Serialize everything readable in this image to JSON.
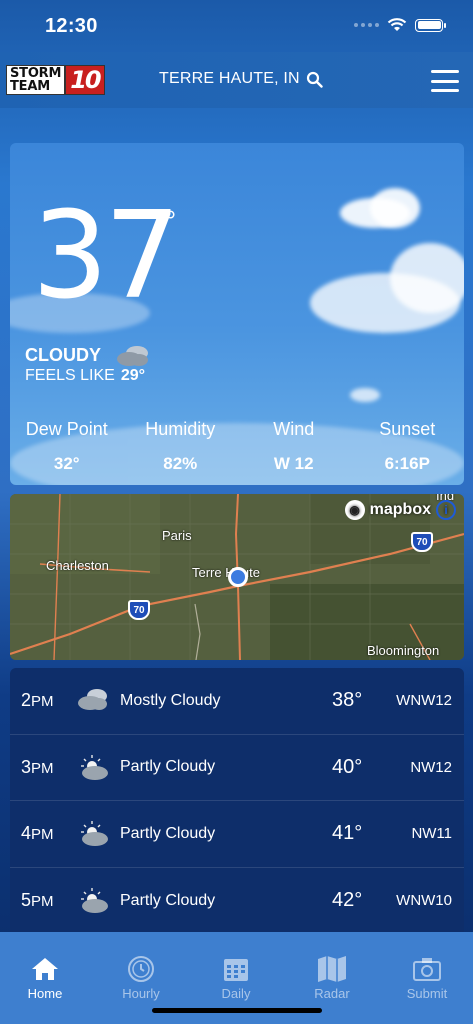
{
  "status_bar": {
    "time": "12:30"
  },
  "header": {
    "logo_line1": "STORM",
    "logo_line2": "TEAM",
    "logo_number": "10",
    "location": "TERRE HAUTE, IN"
  },
  "current": {
    "temperature": "37",
    "degree": "°",
    "condition": "CLOUDY",
    "feels_like_label": "FEELS LIKE",
    "feels_like_value": "29°",
    "stats": [
      {
        "label": "Dew Point",
        "value": "32°"
      },
      {
        "label": "Humidity",
        "value": "82%"
      },
      {
        "label": "Wind",
        "value": "W 12"
      },
      {
        "label": "Sunset",
        "value": "6:16P"
      }
    ]
  },
  "map": {
    "attribution": "mapbox",
    "labels": [
      "Paris",
      "Charleston",
      "Terre Haute",
      "Bloomington",
      "Ind"
    ],
    "highway_shields": [
      "70",
      "70"
    ]
  },
  "hourly": [
    {
      "hour": "2",
      "ampm": "PM",
      "icon": "mostly-cloudy-icon",
      "condition": "Mostly Cloudy",
      "temp": "38°",
      "wind": "WNW12"
    },
    {
      "hour": "3",
      "ampm": "PM",
      "icon": "partly-cloudy-icon",
      "condition": "Partly Cloudy",
      "temp": "40°",
      "wind": "NW12"
    },
    {
      "hour": "4",
      "ampm": "PM",
      "icon": "partly-cloudy-icon",
      "condition": "Partly Cloudy",
      "temp": "41°",
      "wind": "NW11"
    },
    {
      "hour": "5",
      "ampm": "PM",
      "icon": "partly-cloudy-icon",
      "condition": "Partly Cloudy",
      "temp": "42°",
      "wind": "WNW10"
    }
  ],
  "tabs": [
    {
      "label": "Home",
      "icon": "home-icon",
      "active": true
    },
    {
      "label": "Hourly",
      "icon": "clock-icon",
      "active": false
    },
    {
      "label": "Daily",
      "icon": "calendar-icon",
      "active": false
    },
    {
      "label": "Radar",
      "icon": "map-icon",
      "active": false
    },
    {
      "label": "Submit",
      "icon": "camera-icon",
      "active": false
    }
  ]
}
